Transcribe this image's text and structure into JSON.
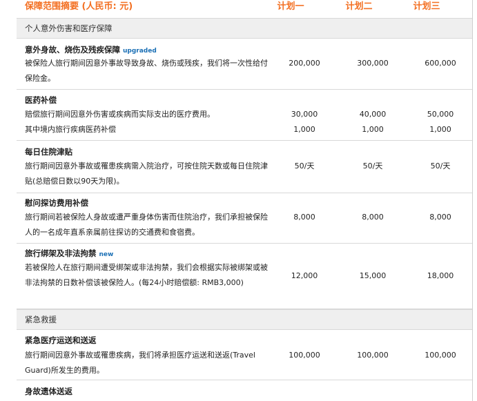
{
  "header": {
    "title": "保障范围摘要 (人民币: 元)",
    "plan1": "计划一",
    "plan2": "计划二",
    "plan3": "计划三"
  },
  "sections": [
    {
      "label": "个人意外伤害和医疗保障"
    },
    {
      "label": "紧急救援"
    }
  ],
  "rows": [
    {
      "title": "意外身故、烧伤及残疾保障",
      "tag": "upgraded",
      "desc": "被保险人旅行期间因意外事故导致身故、烧伤或残疾，我们将一次性给付保险金。",
      "values": [
        "200,000",
        "300,000",
        "600,000"
      ]
    },
    {
      "title": "医药补偿",
      "desc_lines": [
        "赔偿旅行期间因意外伤害或疾病而实际支出的医疗费用。",
        "其中境内旅行疾病医药补偿"
      ],
      "values": [
        "30,000",
        "40,000",
        "50,000"
      ],
      "values2": [
        "1,000",
        "1,000",
        "1,000"
      ]
    },
    {
      "title": "每日住院津贴",
      "desc": "旅行期间因意外事故或罹患疾病需入院治疗，可按住院天数或每日住院津贴(总赔偿日数以90天为限)。",
      "values": [
        "50/天",
        "50/天",
        "50/天"
      ]
    },
    {
      "title": "慰问探访费用补偿",
      "desc": "旅行期间若被保险人身故或遭严重身体伤害而住院治疗，我们承担被保险人的一名成年直系亲属前往探访的交通费和食宿费。",
      "values": [
        "8,000",
        "8,000",
        "8,000"
      ]
    },
    {
      "title": "旅行绑架及非法拘禁",
      "tag": "new",
      "desc": "若被保险人在旅行期间遭受绑架或非法拘禁，我们会根据实际被绑架或被非法拘禁的日数补偿该被保险人。(每24小时赔偿额: RMB3,000)",
      "values": [
        "12,000",
        "15,000",
        "18,000"
      ]
    },
    {
      "title": "紧急医疗运送和送返",
      "desc": "旅行期间因意外事故或罹患疾病，我们将承担医疗运送和送返(Travel Guard)所发生的费用。",
      "values": [
        "100,000",
        "100,000",
        "100,000"
      ]
    },
    {
      "title": "身故遗体送返"
    }
  ]
}
